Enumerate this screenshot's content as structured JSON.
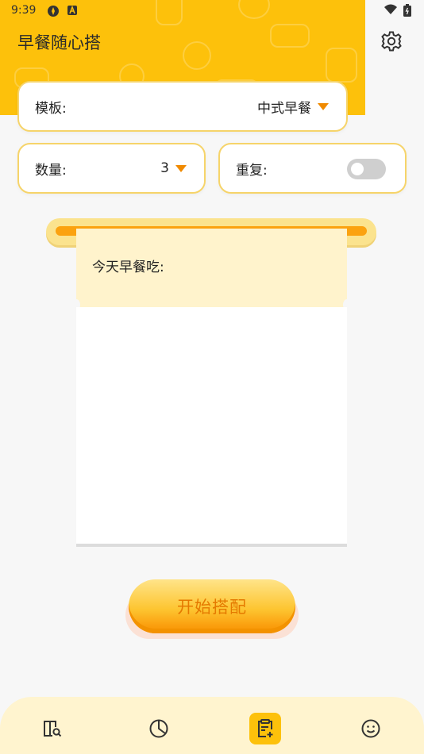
{
  "status_bar": {
    "time": "9:39",
    "icons": [
      "pinwheel-icon",
      "a-badge-icon",
      "wifi-icon",
      "battery-icon"
    ]
  },
  "app": {
    "title": "早餐随心搭",
    "settings_icon": "gear-icon"
  },
  "template_card": {
    "label": "模板:",
    "value": "中式早餐",
    "caret_icon": "caret-down-icon"
  },
  "count_card": {
    "label": "数量:",
    "value": "3",
    "caret_icon": "caret-down-icon"
  },
  "repeat_card": {
    "label": "重复:",
    "toggle_on": false
  },
  "receipt": {
    "heading": "今天早餐吃:"
  },
  "start_button": {
    "label": "开始搭配"
  },
  "bottom_nav": {
    "items": [
      {
        "icon": "book-search-icon",
        "active": false
      },
      {
        "icon": "pie-chart-icon",
        "active": false
      },
      {
        "icon": "clipboard-add-icon",
        "active": true
      },
      {
        "icon": "smiley-icon",
        "active": false
      }
    ]
  },
  "colors": {
    "brand_yellow": "#fdc10b",
    "accent_orange": "#f08a00",
    "card_border": "#f6d46a",
    "receipt_header": "#fff3cc"
  }
}
